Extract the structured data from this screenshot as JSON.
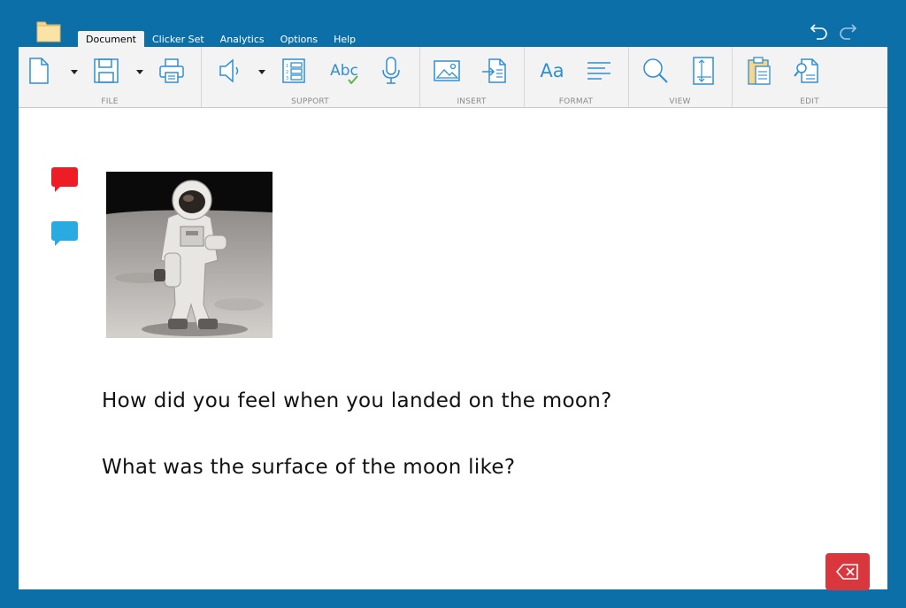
{
  "app": {
    "tabs": [
      {
        "label": "Document",
        "active": true
      },
      {
        "label": "Clicker Set",
        "active": false
      },
      {
        "label": "Analytics",
        "active": false
      },
      {
        "label": "Options",
        "active": false
      },
      {
        "label": "Help",
        "active": false
      }
    ]
  },
  "ribbon": {
    "groups": {
      "file": "FILE",
      "support": "SUPPORT",
      "insert": "INSERT",
      "format": "FORMAT",
      "view": "VIEW",
      "edit": "EDIT"
    },
    "format_font_label": "Aa",
    "spell_label": "Abc"
  },
  "document": {
    "lines": [
      "How did you feel when you landed on the moon?",
      "What was the surface of the moon like?"
    ]
  },
  "colors": {
    "frame": "#0d6fa8",
    "ribbon": "#f3f3f3",
    "icon_blue": "#2f8fd0",
    "bubble_red": "#ee1c25",
    "bubble_blue": "#29abe2",
    "delete_button": "#d9373d"
  }
}
